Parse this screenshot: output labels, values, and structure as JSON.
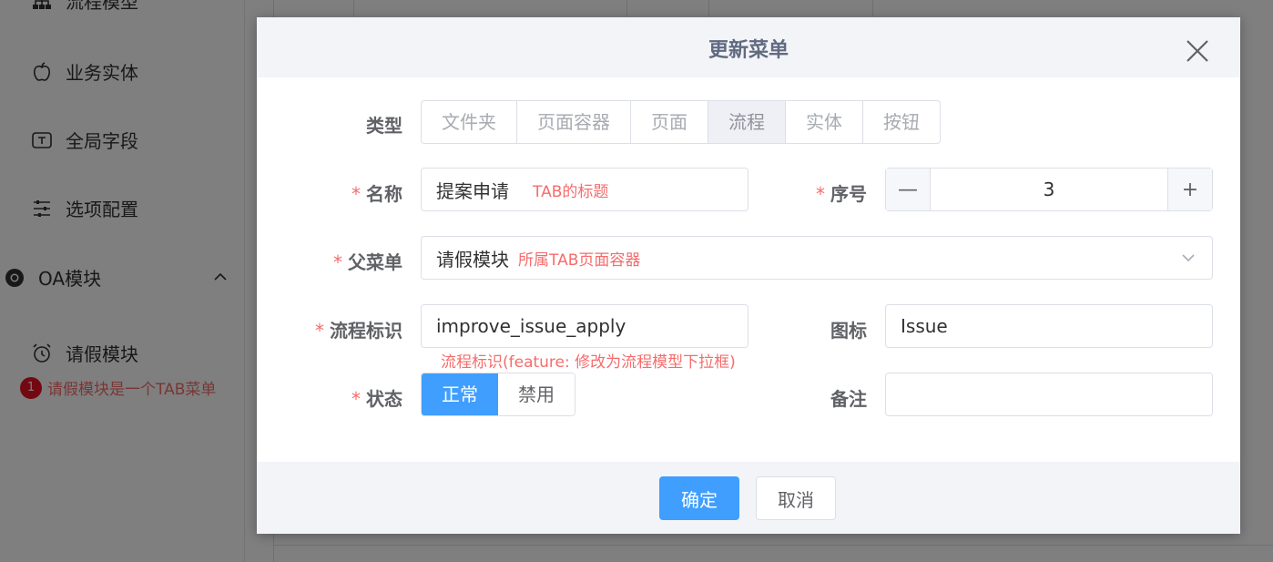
{
  "sidebar": {
    "items": [
      {
        "label": "流程模型",
        "icon": "sitemap-icon"
      },
      {
        "label": "业务实体",
        "icon": "apple-icon"
      },
      {
        "label": "全局字段",
        "icon": "text-box-icon"
      },
      {
        "label": "选项配置",
        "icon": "sliders-icon"
      }
    ],
    "group": {
      "label": "OA模块",
      "icon": "chrome-icon"
    },
    "subitem": {
      "label": "请假模块",
      "icon": "alarm-clock-icon"
    },
    "annotation": {
      "number": "1",
      "text": "请假模块是一个TAB菜单"
    }
  },
  "dialog": {
    "title": "更新菜单",
    "type": {
      "label": "类型",
      "options": [
        "文件夹",
        "页面容器",
        "页面",
        "流程",
        "实体",
        "按钮"
      ],
      "selected": "流程"
    },
    "name": {
      "required": "*",
      "label": "名称",
      "value": "提案申请",
      "annotation": "TAB的标题"
    },
    "order": {
      "required": "*",
      "label": "序号",
      "minus": "—",
      "value": "3",
      "plus": "+"
    },
    "parent": {
      "required": "*",
      "label": "父菜单",
      "value": "请假模块",
      "annotation": "所属TAB页面容器"
    },
    "process_id": {
      "required": "*",
      "label": "流程标识",
      "value": "improve_issue_apply",
      "annotation": "流程标识(feature: 修改为流程模型下拉框)"
    },
    "icon": {
      "label": "图标",
      "value": "Issue"
    },
    "status": {
      "required": "*",
      "label": "状态",
      "options": [
        "正常",
        "禁用"
      ],
      "selected": "正常"
    },
    "remark": {
      "label": "备注",
      "value": ""
    },
    "confirm_label": "确定",
    "cancel_label": "取消"
  },
  "colors": {
    "primary": "#409eff",
    "required": "#f56c6c",
    "annotation_badge": "#e81123"
  }
}
